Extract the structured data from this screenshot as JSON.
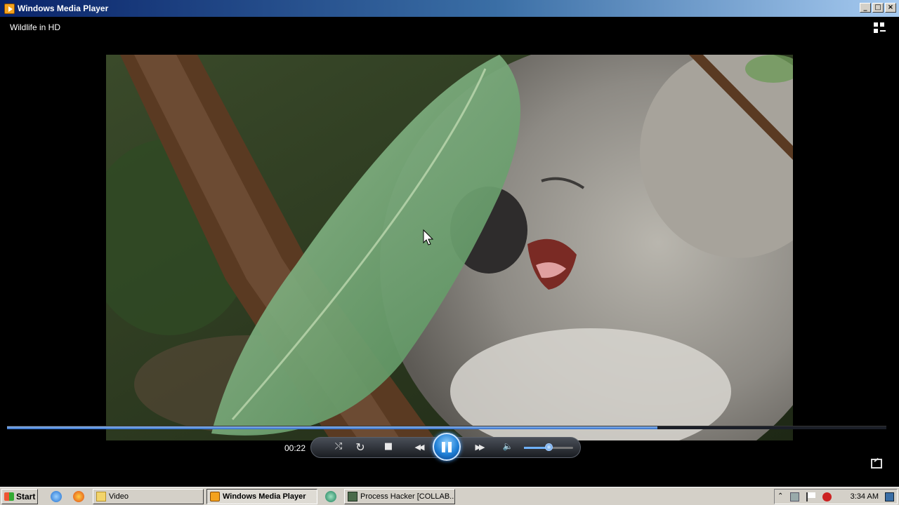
{
  "window": {
    "title": "Windows Media Player",
    "controls": {
      "minimize": "_",
      "maximize": "□",
      "close": "×"
    }
  },
  "player": {
    "media_title": "Wildlife in HD",
    "elapsed": "00:22",
    "progress": 0.74,
    "volume": 0.5,
    "state": "playing"
  },
  "icons": {
    "shuffle": "⤭",
    "repeat": "↻",
    "stop": "■",
    "rewind": "◀◀",
    "fast_forward": "▶▶",
    "volume": "🔈"
  },
  "taskbar": {
    "start_label": "Start",
    "buttons": [
      {
        "label": "Video",
        "active": false
      },
      {
        "label": "Windows Media Player",
        "active": true
      },
      {
        "label": "Process Hacker [COLLAB...",
        "active": false
      }
    ],
    "clock": "3:34 AM"
  },
  "colors": {
    "title_gradient_start": "#0a246a",
    "title_gradient_end": "#a6caf0",
    "accent_blue": "#2f6cc8",
    "taskbar_gray": "#d4d0c8"
  }
}
